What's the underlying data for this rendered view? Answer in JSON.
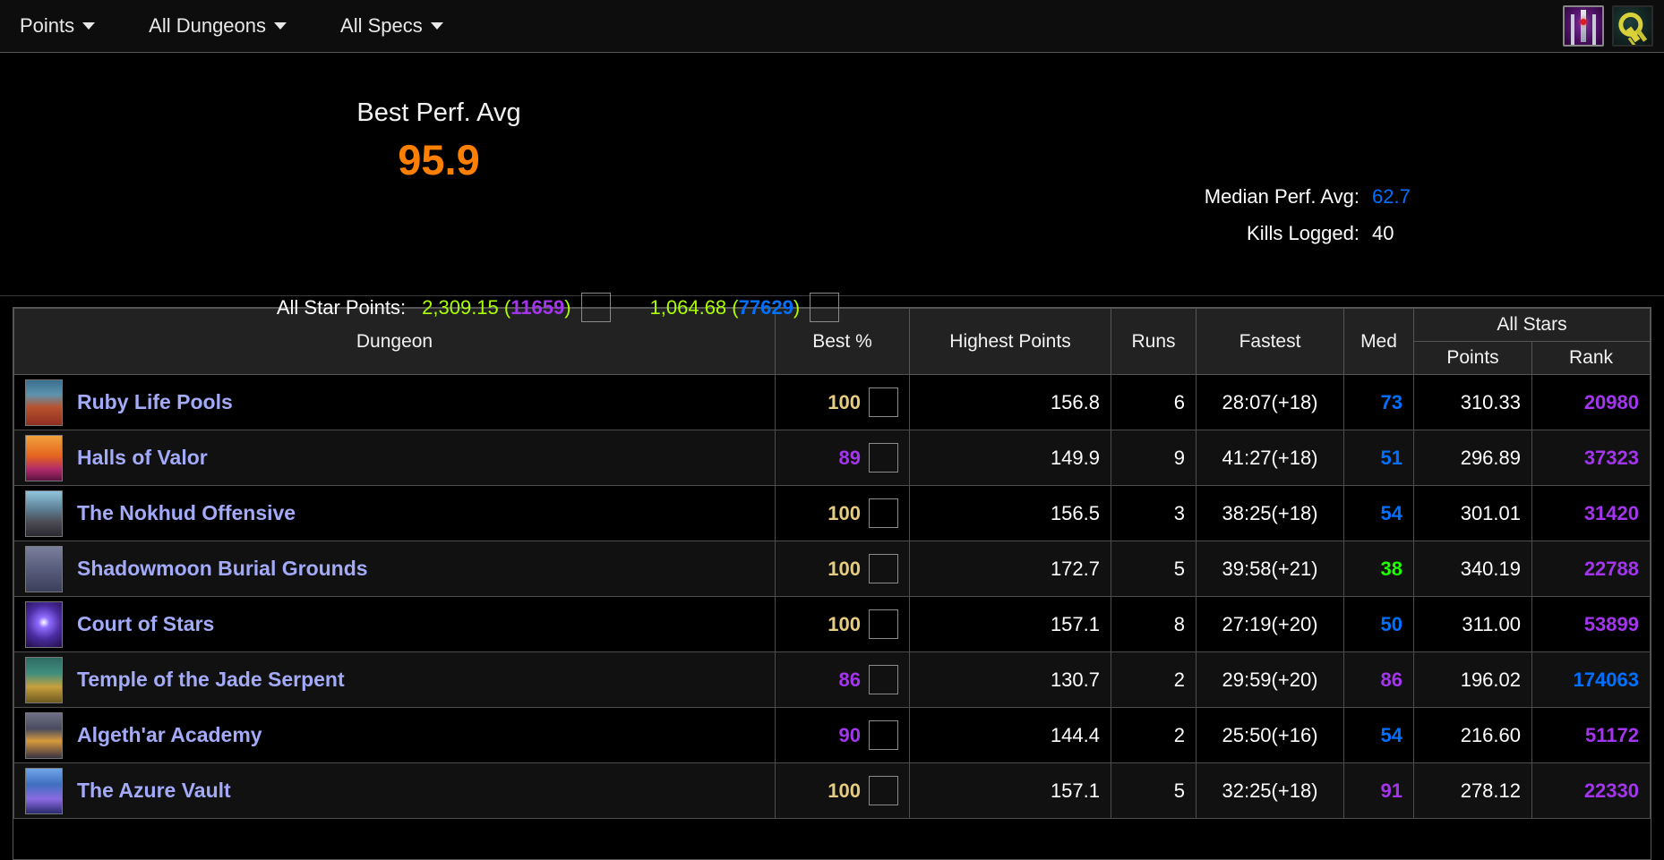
{
  "nav": {
    "items": [
      {
        "label": "Points",
        "name": "nav-points"
      },
      {
        "label": "All Dungeons",
        "name": "nav-all-dungeons"
      },
      {
        "label": "All Specs",
        "name": "nav-all-specs"
      }
    ],
    "right_icons": [
      {
        "name": "swords-icon",
        "title": "Melee / DPS Specs"
      },
      {
        "name": "key-icon",
        "title": "Mythic Keystone"
      }
    ]
  },
  "summary": {
    "best_label": "Best Perf. Avg",
    "best_value": "95.9",
    "best_color": "#ff8000",
    "median_label": "Median Perf. Avg:",
    "median_value": "62.7",
    "median_color": "#0070ff",
    "kills_label": "Kills Logged:",
    "kills_value": "40",
    "allstar_label": "All Star Points:",
    "allstar": [
      {
        "points": "2,309.15",
        "rank": "11659",
        "rank_color": "#a335ee",
        "icon": "devastation-evoker-icon"
      },
      {
        "points": "1,064.68",
        "rank": "77629",
        "rank_color": "#0070ff",
        "icon": "preservation-evoker-icon"
      }
    ]
  },
  "table": {
    "headers": {
      "dungeon": "Dungeon",
      "best": "Best %",
      "highest_points": "Highest Points",
      "runs": "Runs",
      "fastest": "Fastest",
      "med": "Med",
      "all_stars": "All Stars",
      "as_points": "Points",
      "as_rank": "Rank"
    },
    "rows": [
      {
        "dungeon": "Ruby Life Pools",
        "thumb": "t-ruby",
        "best": "100",
        "best_color": "#e5cc80",
        "spec_icon": "devastation-evoker-icon",
        "highest_points": "156.8",
        "runs": "6",
        "fastest": "28:07(+18)",
        "med": "73",
        "med_color": "#0070ff",
        "as_points": "310.33",
        "as_rank": "20980",
        "as_rank_color": "#a335ee"
      },
      {
        "dungeon": "Halls of Valor",
        "thumb": "t-hov",
        "best": "89",
        "best_color": "#a335ee",
        "spec_icon": "devastation-evoker-icon",
        "highest_points": "149.9",
        "runs": "9",
        "fastest": "41:27(+18)",
        "med": "51",
        "med_color": "#0070ff",
        "as_points": "296.89",
        "as_rank": "37323",
        "as_rank_color": "#a335ee"
      },
      {
        "dungeon": "The Nokhud Offensive",
        "thumb": "t-nokhud",
        "best": "100",
        "best_color": "#e5cc80",
        "spec_icon": "devastation-evoker-icon",
        "highest_points": "156.5",
        "runs": "3",
        "fastest": "38:25(+18)",
        "med": "54",
        "med_color": "#0070ff",
        "as_points": "301.01",
        "as_rank": "31420",
        "as_rank_color": "#a335ee"
      },
      {
        "dungeon": "Shadowmoon Burial Grounds",
        "thumb": "t-sbg",
        "best": "100",
        "best_color": "#e5cc80",
        "spec_icon": "devastation-evoker-icon",
        "highest_points": "172.7",
        "runs": "5",
        "fastest": "39:58(+21)",
        "med": "38",
        "med_color": "#1eff00",
        "as_points": "340.19",
        "as_rank": "22788",
        "as_rank_color": "#a335ee"
      },
      {
        "dungeon": "Court of Stars",
        "thumb": "t-cos",
        "best": "100",
        "best_color": "#e5cc80",
        "spec_icon": "devastation-evoker-icon",
        "highest_points": "157.1",
        "runs": "8",
        "fastest": "27:19(+20)",
        "med": "50",
        "med_color": "#0070ff",
        "as_points": "311.00",
        "as_rank": "53899",
        "as_rank_color": "#a335ee"
      },
      {
        "dungeon": "Temple of the Jade Serpent",
        "thumb": "t-tjs",
        "best": "86",
        "best_color": "#a335ee",
        "spec_icon": "preservation-evoker-icon",
        "highest_points": "130.7",
        "runs": "2",
        "fastest": "29:59(+20)",
        "med": "86",
        "med_color": "#a335ee",
        "as_points": "196.02",
        "as_rank": "174063",
        "as_rank_color": "#0070ff"
      },
      {
        "dungeon": "Algeth'ar Academy",
        "thumb": "t-aa",
        "best": "90",
        "best_color": "#a335ee",
        "spec_icon": "devastation-evoker-icon",
        "highest_points": "144.4",
        "runs": "2",
        "fastest": "25:50(+16)",
        "med": "54",
        "med_color": "#0070ff",
        "as_points": "216.60",
        "as_rank": "51172",
        "as_rank_color": "#a335ee"
      },
      {
        "dungeon": "The Azure Vault",
        "thumb": "t-tav",
        "best": "100",
        "best_color": "#e5cc80",
        "spec_icon": "devastation-evoker-icon",
        "highest_points": "157.1",
        "runs": "5",
        "fastest": "32:25(+18)",
        "med": "91",
        "med_color": "#a335ee",
        "as_points": "278.12",
        "as_rank": "22330",
        "as_rank_color": "#a335ee"
      }
    ]
  }
}
